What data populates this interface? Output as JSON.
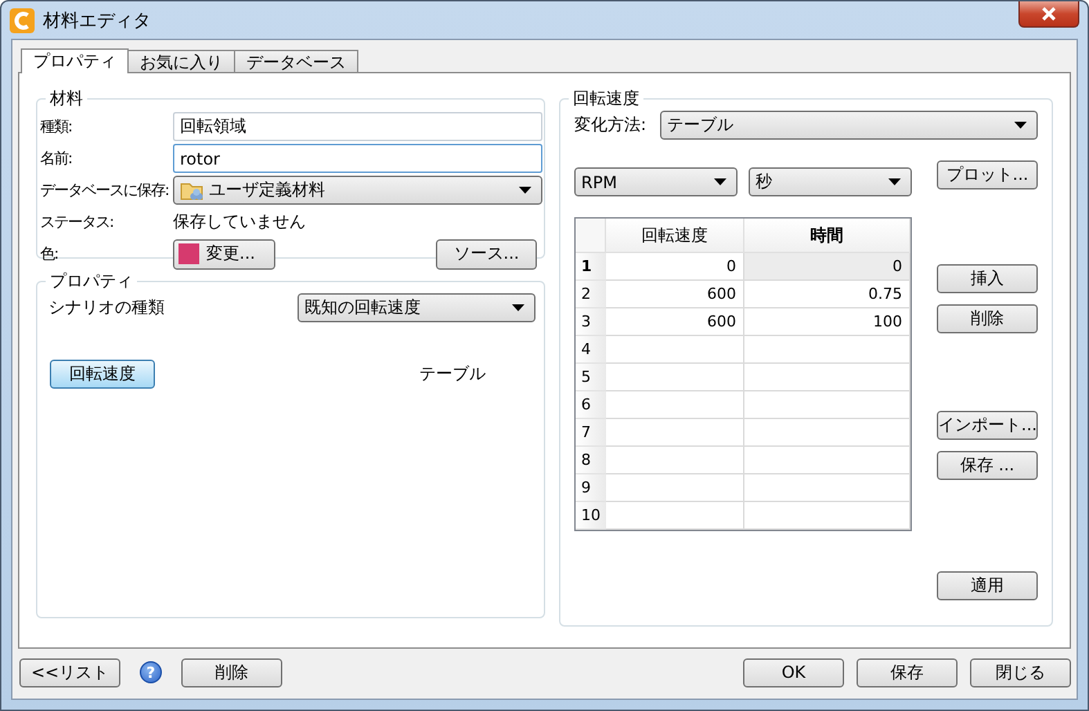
{
  "window": {
    "title": "材料エディタ"
  },
  "tabs": [
    {
      "label": "プロパティ",
      "selected": true
    },
    {
      "label": "お気に入り",
      "selected": false
    },
    {
      "label": "データベース",
      "selected": false
    }
  ],
  "material": {
    "title": "材料",
    "type": {
      "label": "種類:",
      "value": "回転領域",
      "focused": false
    },
    "name": {
      "label": "名前:",
      "value": "rotor",
      "focused": true
    },
    "database": {
      "label": "データベースに保存:",
      "value": "ユーザ定義材料"
    },
    "status": {
      "label": "ステータス:",
      "value": "保存していません"
    },
    "color": {
      "label": "色:",
      "color": "#d63a6e",
      "change_button": "変更...",
      "source_button": "ソース..."
    }
  },
  "properties": {
    "title": "プロパティ",
    "scenario": {
      "label": "シナリオの種類",
      "value": "既知の回転速度"
    },
    "rows": [
      {
        "button": "回転速度",
        "value": "テーブル"
      }
    ]
  },
  "rotation": {
    "title": "回転速度",
    "method": {
      "label": "変化方法:",
      "value": "テーブル"
    },
    "units": [
      "RPM",
      "秒"
    ],
    "plot_button": "プロット...",
    "table": {
      "columns": [
        "回転速度",
        "時間"
      ],
      "rows": [
        {
          "number": "1",
          "cells": [
            "0",
            "0"
          ],
          "selected": true
        },
        {
          "number": "2",
          "cells": [
            "600",
            "0.75"
          ],
          "selected": false
        },
        {
          "number": "3",
          "cells": [
            "600",
            "100"
          ],
          "selected": false
        },
        {
          "number": "4",
          "cells": [],
          "selected": false
        },
        {
          "number": "5",
          "cells": [],
          "selected": false
        },
        {
          "number": "6",
          "cells": [],
          "selected": false
        },
        {
          "number": "7",
          "cells": [],
          "selected": false
        },
        {
          "number": "8",
          "cells": [],
          "selected": false
        },
        {
          "number": "9",
          "cells": [],
          "selected": false
        },
        {
          "number": "10",
          "cells": [],
          "selected": false
        }
      ]
    },
    "row_buttons": [
      "挿入",
      "削除"
    ],
    "file_buttons": [
      "インポート...",
      "保存 ..."
    ],
    "apply_button": "適用"
  },
  "footer": {
    "list_button": "<<リスト",
    "help": "?",
    "delete_button": "削除",
    "buttons": [
      "OK",
      "保存",
      "閉じる"
    ]
  }
}
